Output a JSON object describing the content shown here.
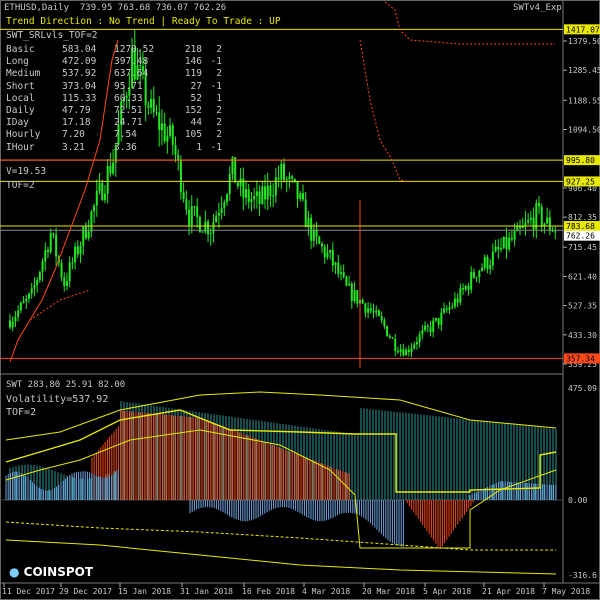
{
  "header": {
    "symbol_info": "ETHUSD,Daily  739.95 763.68 736.07 762.26",
    "indicator_name": "SWTv4_Exp",
    "signal": "Trend Direction : No Trend  |  Ready To Trade : UP"
  },
  "panel": {
    "title": "SWT_SRLvls_TOF=2",
    "rows": [
      [
        "Basic",
        "583.04",
        "1270.52",
        "218",
        "2"
      ],
      [
        "Long",
        "472.09",
        "397.48",
        "146",
        "-1"
      ],
      [
        "Medium",
        "537.92",
        "637.64",
        "119",
        "2"
      ],
      [
        "Short",
        "373.04",
        "95.71",
        "27",
        "-1"
      ],
      [
        "Local",
        "115.33",
        "60.33",
        "52",
        "1"
      ],
      [
        "Daily",
        "47.79",
        "72.51",
        "152",
        "2"
      ],
      [
        "IDay",
        "17.18",
        "24.71",
        "44",
        "2"
      ],
      [
        "Hourly",
        "7.20",
        "7.54",
        "105",
        "2"
      ],
      [
        "IHour",
        "3.21",
        "3.36",
        "1",
        "-1"
      ]
    ],
    "v_label": "V=19.53",
    "tof_label": "TOF=2"
  },
  "sub": {
    "title": "SWT 283.80 25.91 82.00",
    "volatility": "Volatility=537.92",
    "tof": "TOF=2"
  },
  "price_axis": [
    "1379.50",
    "1285.45",
    "1188.55",
    "1094.50",
    "906.40",
    "812.35",
    "715.45",
    "621.40",
    "527.35",
    "433.30",
    "339.25"
  ],
  "price_levels": [
    {
      "value": "1417.07",
      "bg": "#e8e800",
      "fg": "#000"
    },
    {
      "value": "995.80",
      "bg": "#e8e800",
      "fg": "#000"
    },
    {
      "value": "927.25",
      "bg": "#e8e800",
      "fg": "#000"
    },
    {
      "value": "783.68",
      "bg": "#e8e800",
      "fg": "#000"
    },
    {
      "value": "762.26",
      "bg": "#ffffff",
      "fg": "#000"
    },
    {
      "value": "357.34",
      "bg": "#ff4a1a",
      "fg": "#000"
    }
  ],
  "sub_axis": [
    "475.09",
    "0.00",
    "-316.6"
  ],
  "time_axis": [
    "11 Dec 2017",
    "29 Dec 2017",
    "15 Jan 2018",
    "31 Jan 2018",
    "16 Feb 2018",
    "4 Mar 2018",
    "20 Mar 2018",
    "5 Apr 2018",
    "21 Apr 2018",
    "7 May 2018"
  ],
  "logo": {
    "prefix": "●",
    "text": "COINSPOT"
  },
  "colors": {
    "bull": "#22e822",
    "bear": "#22e822",
    "level": "#e8e800",
    "orange": "#ff4a1a",
    "blue": "#6fa4e0",
    "teal": "#2f9aa0",
    "grid": "#222"
  }
}
